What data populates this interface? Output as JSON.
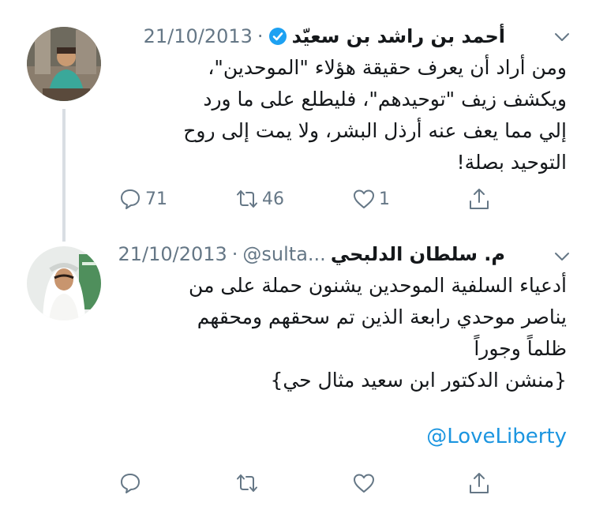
{
  "tweets": [
    {
      "name": "أحمد بن راشد بن سعيّد",
      "verified": true,
      "handle": "",
      "separator": "·",
      "date": "21/10/2013",
      "lines": [
        "ومن أراد أن يعرف حقيقة هؤلاء \"الموحدين\"،",
        "ويكشف زيف \"توحيدهم\"، فليطلع على ما ورد",
        "إلي مما يعف عنه أرذل البشر، ولا يمت إلى روح",
        "التوحيد بصلة!"
      ],
      "reply_count": "71",
      "retweet_count": "46",
      "like_count": "1"
    },
    {
      "name": "م. سلطان الدلبحي",
      "verified": false,
      "handle": "@sulta...",
      "separator": "·",
      "date": "21/10/2013",
      "lines": [
        "أدعياء السلفية الموحدين يشنون حملة على من",
        "يناصر موحدي رابعة الذين تم سحقهم ومحقهم",
        "ظلماً وجوراً",
        "{منشن الدكتور ابن سعيد مثال حي}"
      ],
      "mention": "@LoveLiberty",
      "reply_count": "",
      "retweet_count": "",
      "like_count": ""
    }
  ],
  "colors": {
    "text": "#14171a",
    "secondary": "#657786",
    "link": "#1b95e0",
    "verified": "#1da1f2",
    "thread_line": "#d9dee3"
  },
  "icons": [
    "reply-icon",
    "retweet-icon",
    "like-icon",
    "share-icon",
    "verified-badge-icon",
    "chevron-down-icon"
  ]
}
